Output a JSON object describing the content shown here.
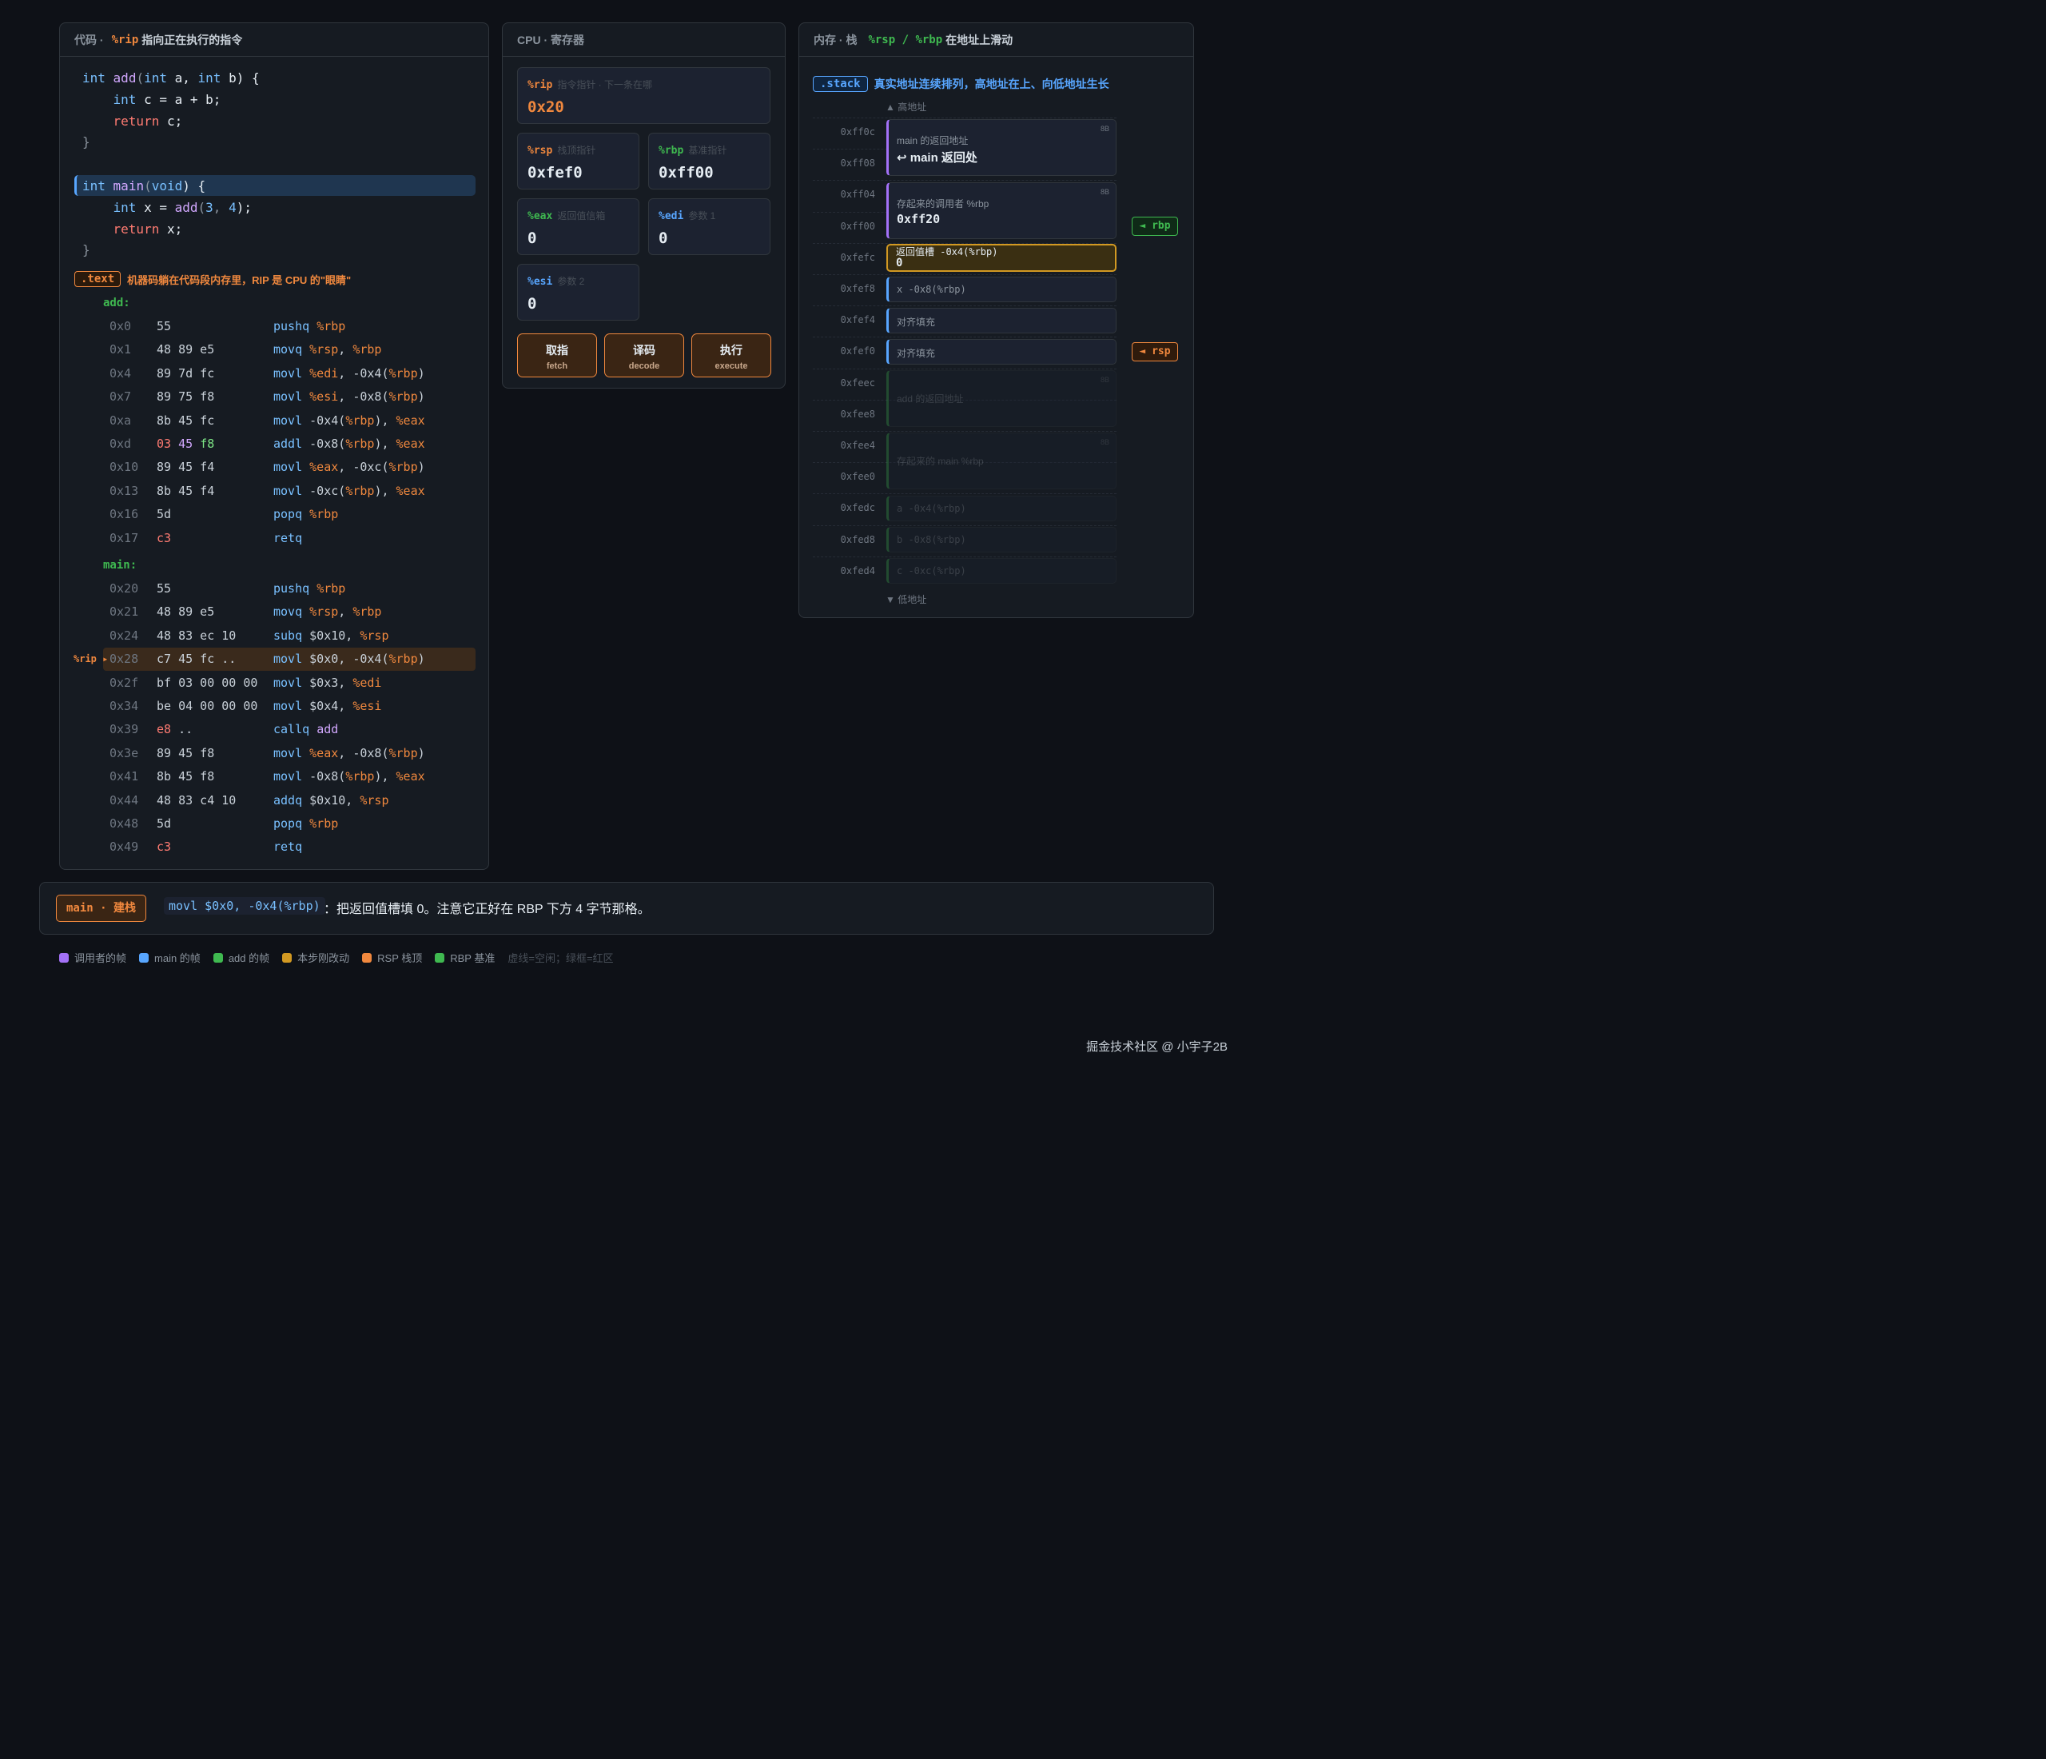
{
  "code_panel": {
    "title": "代码 ·",
    "title_hl": "%rip",
    "title_rest": "指向正在执行的指令",
    "source": [
      [
        "int",
        " ",
        "add",
        "(",
        "int",
        " a, ",
        "int",
        " b) {"
      ],
      [
        "    ",
        "int",
        " c = a + b;"
      ],
      [
        "    ",
        "return",
        " c;"
      ],
      [
        "}"
      ],
      [
        "int",
        " ",
        "main",
        "(",
        "void",
        ") {"
      ],
      [
        "    ",
        "int",
        " x = ",
        "add",
        "(",
        "3",
        ", ",
        "4",
        ");"
      ],
      [
        "    ",
        "return",
        " x;"
      ],
      [
        "}"
      ]
    ],
    "text_badge": ".text",
    "text_desc": "机器码躺在代码段内存里，RIP 是 CPU 的\"眼睛\"",
    "add_label": "add:",
    "main_label": "main:",
    "rip_marker": "%rip",
    "add_asm": [
      {
        "addr": "0x0",
        "bytes": "55",
        "op": "pushq",
        "args": "%rbp"
      },
      {
        "addr": "0x1",
        "bytes": "48 89 e5",
        "op": "movq",
        "args": "%rsp, %rbp"
      },
      {
        "addr": "0x4",
        "bytes": "89 7d fc",
        "op": "movl",
        "args": "%edi, -0x4(%rbp)"
      },
      {
        "addr": "0x7",
        "bytes": "89 75 f8",
        "op": "movl",
        "args": "%esi, -0x8(%rbp)"
      },
      {
        "addr": "0xa",
        "bytes": "8b 45 fc",
        "op": "movl",
        "args": "-0x4(%rbp), %eax"
      },
      {
        "addr": "0xd",
        "bytes": "03 45 f8",
        "op": "addl",
        "args": "-0x8(%rbp), %eax"
      },
      {
        "addr": "0x10",
        "bytes": "89 45 f4",
        "op": "movl",
        "args": "%eax, -0xc(%rbp)"
      },
      {
        "addr": "0x13",
        "bytes": "8b 45 f4",
        "op": "movl",
        "args": "-0xc(%rbp), %eax"
      },
      {
        "addr": "0x16",
        "bytes": "5d",
        "op": "popq",
        "args": "%rbp"
      },
      {
        "addr": "0x17",
        "bytes": "c3",
        "op": "retq",
        "args": ""
      }
    ],
    "main_asm": [
      {
        "addr": "0x20",
        "bytes": "55",
        "op": "pushq",
        "args": "%rbp"
      },
      {
        "addr": "0x21",
        "bytes": "48 89 e5",
        "op": "movq",
        "args": "%rsp, %rbp"
      },
      {
        "addr": "0x24",
        "bytes": "48 83 ec 10",
        "op": "subq",
        "args": "$0x10, %rsp"
      },
      {
        "addr": "0x28",
        "bytes": "c7 45 fc ..",
        "op": "movl",
        "args": "$0x0, -0x4(%rbp)"
      },
      {
        "addr": "0x2f",
        "bytes": "bf 03 00 00 00",
        "op": "movl",
        "args": "$0x3, %edi"
      },
      {
        "addr": "0x34",
        "bytes": "be 04 00 00 00",
        "op": "movl",
        "args": "$0x4, %esi"
      },
      {
        "addr": "0x39",
        "bytes": "e8 ..",
        "op": "callq",
        "args": "add"
      },
      {
        "addr": "0x3e",
        "bytes": "89 45 f8",
        "op": "movl",
        "args": "%eax, -0x8(%rbp)"
      },
      {
        "addr": "0x41",
        "bytes": "8b 45 f8",
        "op": "movl",
        "args": "-0x8(%rbp), %eax"
      },
      {
        "addr": "0x44",
        "bytes": "48 83 c4 10",
        "op": "addq",
        "args": "$0x10, %rsp"
      },
      {
        "addr": "0x48",
        "bytes": "5d",
        "op": "popq",
        "args": "%rbp"
      },
      {
        "addr": "0x49",
        "bytes": "c3",
        "op": "retq",
        "args": ""
      }
    ]
  },
  "cpu_panel": {
    "title": "CPU · 寄存器",
    "registers": {
      "rip": {
        "name": "%rip",
        "desc": "指令指针 · 下一条在哪",
        "value": "0x20"
      },
      "rsp": {
        "name": "%rsp",
        "desc": "栈顶指针",
        "value": "0xfef0"
      },
      "rbp": {
        "name": "%rbp",
        "desc": "基准指针",
        "value": "0xff00"
      },
      "eax": {
        "name": "%eax",
        "desc": "返回值信箱",
        "value": "0"
      },
      "edi": {
        "name": "%edi",
        "desc": "参数 1",
        "value": "0"
      },
      "esi": {
        "name": "%esi",
        "desc": "参数 2",
        "value": "0"
      }
    },
    "buttons": {
      "fetch": {
        "label": "取指",
        "sub": "fetch"
      },
      "decode": {
        "label": "译码",
        "sub": "decode"
      },
      "execute": {
        "label": "执行",
        "sub": "execute"
      }
    }
  },
  "stack_panel": {
    "title": "内存 · 栈",
    "title_hl": "%rsp / %rbp",
    "title_rest": "在地址上滑动",
    "badge": ".stack",
    "desc": "真实地址连续排列，高地址在上、向低地址生长",
    "high_label": "▲ 高地址",
    "low_label": "▼ 低地址",
    "addresses": [
      "0xff0c",
      "0xff08",
      "0xff04",
      "0xff00",
      "0xfefc",
      "0xfef8",
      "0xfef4",
      "0xfef0",
      "0xfeec",
      "0xfee8",
      "0xfee4",
      "0xfee0",
      "0xfedc",
      "0xfed8",
      "0xfed4"
    ],
    "cells": {
      "main_ret": {
        "label": "main 的返回地址",
        "value": "↩ main 返回处",
        "size": "8B"
      },
      "saved_rbp": {
        "label": "存起来的调用者 %rbp",
        "value": "0xff20",
        "size": "8B"
      },
      "ret_slot": {
        "label": "返回值槽 -0x4(%rbp)",
        "value": "0"
      },
      "x": {
        "label": "x -0x8(%rbp)"
      },
      "pad1": {
        "label": "对齐填充"
      },
      "pad2": {
        "label": "对齐填充"
      },
      "add_ret": {
        "label": "add 的返回地址",
        "size": "8B"
      },
      "saved_main_rbp": {
        "label": "存起来的 main %rbp",
        "size": "8B"
      },
      "a": {
        "label": "a -0x4(%rbp)"
      },
      "b": {
        "label": "b -0x8(%rbp)"
      },
      "c": {
        "label": "c -0xc(%rbp)"
      }
    },
    "rbp_pointer": "◄ rbp",
    "rsp_pointer": "◄ rsp"
  },
  "info_bar": {
    "badge": "main · 建栈",
    "code": "movl $0x0, -0x4(%rbp)",
    "text": "：把返回值槽填 0。注意它正好在 RBP 下方 4 字节那格。"
  },
  "legend": {
    "items": [
      {
        "label": "调用者的帧",
        "color": "#a371f7"
      },
      {
        "label": "main 的帧",
        "color": "#58a6ff"
      },
      {
        "label": "add 的帧",
        "color": "#3fb950"
      },
      {
        "label": "本步刚改动",
        "color": "#d29922"
      },
      {
        "label": "RSP 栈顶",
        "color": "#f0883e"
      },
      {
        "label": "RBP 基准",
        "color": "#3fb950"
      }
    ],
    "note": "虚线=空闲；绿框=红区"
  },
  "footer": "掘金技术社区 @ 小宇子2B"
}
